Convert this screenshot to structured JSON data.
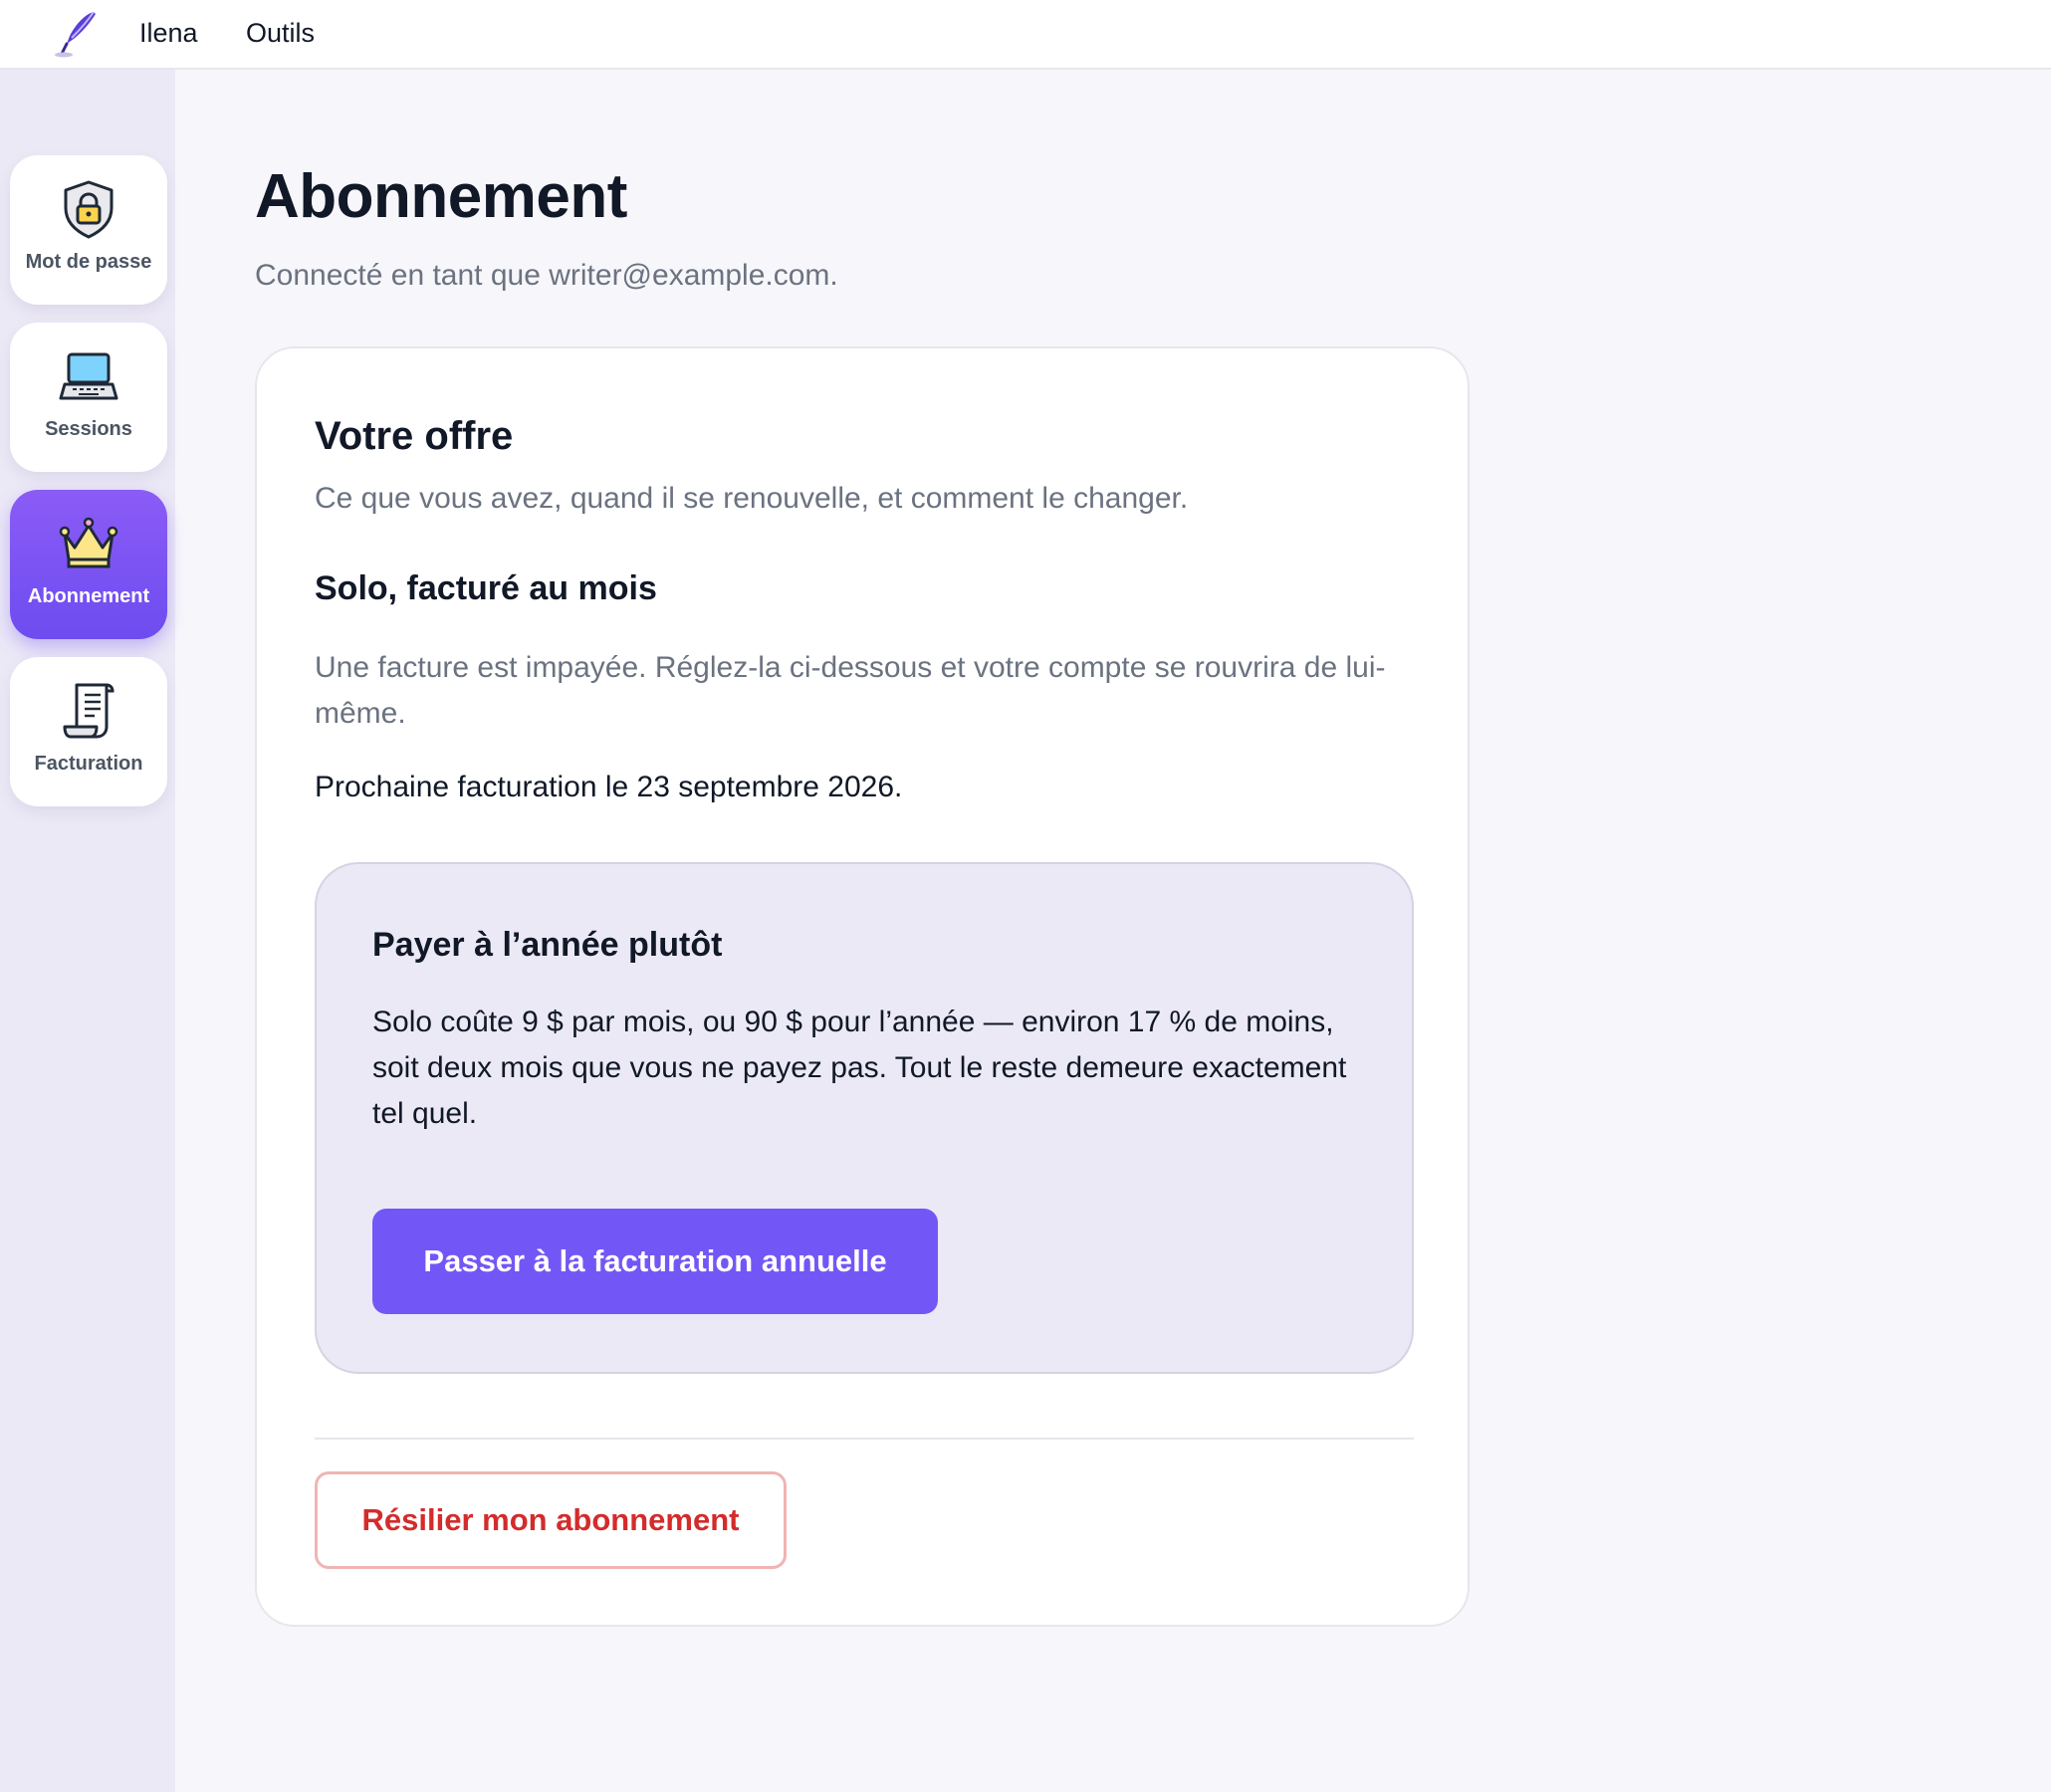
{
  "topbar": {
    "app_name": "Ilena",
    "tools_label": "Outils",
    "logo_icon": "quill-pen-icon"
  },
  "sidebar": {
    "items": [
      {
        "label": "Mot de passe",
        "icon": "shield-lock-icon",
        "active": false
      },
      {
        "label": "Sessions",
        "icon": "laptop-icon",
        "active": false
      },
      {
        "label": "Abonnement",
        "icon": "crown-icon",
        "active": true
      },
      {
        "label": "Facturation",
        "icon": "receipt-icon",
        "active": false
      }
    ]
  },
  "main": {
    "title": "Abonnement",
    "subtitle": "Connecté en tant que writer@example.com.",
    "card": {
      "title": "Votre offre",
      "subtitle": "Ce que vous avez, quand il se renouvelle, et comment le changer.",
      "plan_name": "Solo, facturé au mois",
      "warning": "Une facture est impayée. Réglez-la ci-dessous et votre compte se rouvrira de lui-même.",
      "next_billing": "Prochaine facturation le 23 septembre 2026.",
      "upsell": {
        "title": "Payer à l’année plutôt",
        "text": "Solo coûte 9 $ par mois, ou 90 $ pour l’année — environ 17 % de moins, soit deux mois que vous ne payez pas. Tout le reste demeure exactement tel quel.",
        "button_label": "Passer à la facturation annuelle"
      },
      "cancel_label": "Résilier mon abonnement"
    }
  },
  "colors": {
    "accent": "#7357f6",
    "danger": "#d42b2b",
    "danger_border": "#f0b4b4",
    "upsell_bg": "#ebe9f5",
    "sidebar_bg": "#ece9f6",
    "page_bg": "#f7f7fb"
  }
}
